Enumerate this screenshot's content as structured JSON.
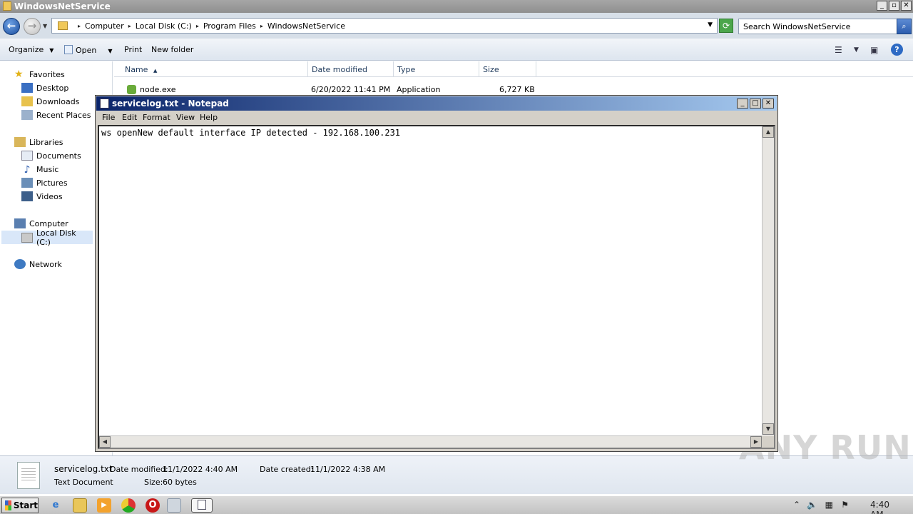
{
  "explorer": {
    "title": "WindowsNetService",
    "breadcrumbs": [
      "Computer",
      "Local Disk (C:)",
      "Program Files",
      "WindowsNetService"
    ],
    "search_placeholder": "Search WindowsNetService",
    "toolbar": {
      "organize": "Organize",
      "open": "Open",
      "print": "Print",
      "new_folder": "New folder"
    },
    "nav": {
      "favorites": "Favorites",
      "desktop": "Desktop",
      "downloads": "Downloads",
      "recent": "Recent Places",
      "libraries": "Libraries",
      "documents": "Documents",
      "music": "Music",
      "pictures": "Pictures",
      "videos": "Videos",
      "computer": "Computer",
      "local_disk": "Local Disk (C:)",
      "network": "Network"
    },
    "columns": {
      "name": "Name",
      "date": "Date modified",
      "type": "Type",
      "size": "Size"
    },
    "files": [
      {
        "name": "node.exe",
        "date": "6/20/2022 11:41 PM",
        "type": "Application",
        "size": "6,727 KB"
      }
    ],
    "details": {
      "filename": "servicelog.txt",
      "filetype": "Text Document",
      "modified_label": "Date modified:",
      "modified": "11/1/2022 4:40 AM",
      "created_label": "Date created:",
      "created": "11/1/2022 4:38 AM",
      "size_label": "Size:",
      "size": "60 bytes"
    }
  },
  "notepad": {
    "title": "servicelog.txt - Notepad",
    "menu": {
      "file": "File",
      "edit": "Edit",
      "format": "Format",
      "view": "View",
      "help": "Help"
    },
    "content": "ws openNew default interface IP detected - 192.168.100.231"
  },
  "taskbar": {
    "start": "Start",
    "clock": "4:40 AM"
  },
  "watermark": "ANY RUN"
}
